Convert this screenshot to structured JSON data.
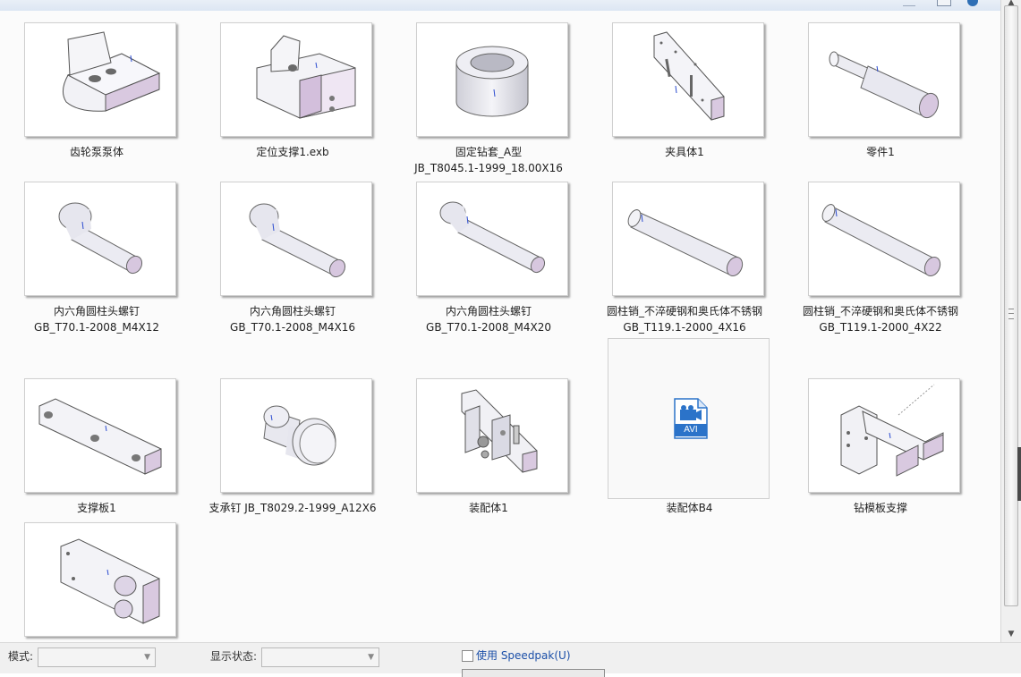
{
  "files": [
    {
      "id": "gear-pump-body",
      "caption": [
        "齿轮泵泵体"
      ]
    },
    {
      "id": "locating-support",
      "caption": [
        "定位支撑1.exb"
      ]
    },
    {
      "id": "fixed-drill-bush",
      "caption": [
        "固定钻套_A型",
        "JB_T8045.1-1999_18.00X16"
      ]
    },
    {
      "id": "fixture-body",
      "caption": [
        "夹具体1"
      ]
    },
    {
      "id": "part1",
      "caption": [
        "零件1"
      ]
    },
    {
      "id": "socket-screw-m4x12",
      "caption": [
        "内六角圆柱头螺钉",
        "GB_T70.1-2008_M4X12"
      ]
    },
    {
      "id": "socket-screw-m4x16",
      "caption": [
        "内六角圆柱头螺钉",
        "GB_T70.1-2008_M4X16"
      ]
    },
    {
      "id": "socket-screw-m4x20",
      "caption": [
        "内六角圆柱头螺钉",
        "GB_T70.1-2008_M4X20"
      ]
    },
    {
      "id": "dowel-pin-4x16",
      "caption": [
        "圆柱销_不淬硬钢和奥氏体不锈钢",
        "GB_T119.1-2000_4X16"
      ]
    },
    {
      "id": "dowel-pin-4x22",
      "caption": [
        "圆柱销_不淬硬钢和奥氏体不锈钢",
        "GB_T119.1-2000_4X22"
      ]
    },
    {
      "id": "support-plate",
      "caption": [
        "支撑板1"
      ]
    },
    {
      "id": "support-pin",
      "caption": [
        "支承钉 JB_T8029.2-1999_A12X6"
      ]
    },
    {
      "id": "assembly1",
      "caption": [
        "装配体1"
      ]
    },
    {
      "id": "assembly-b4",
      "caption": [
        "装配体B4"
      ],
      "badge": "AVI"
    },
    {
      "id": "drill-plate-support",
      "caption": [
        "钻模板支撑"
      ]
    },
    {
      "id": "plate-part",
      "caption": []
    }
  ],
  "bottom": {
    "mode_label": "模式:",
    "display_state_label": "显示状态:",
    "speedpak_label": "使用 Speedpak(U)"
  }
}
